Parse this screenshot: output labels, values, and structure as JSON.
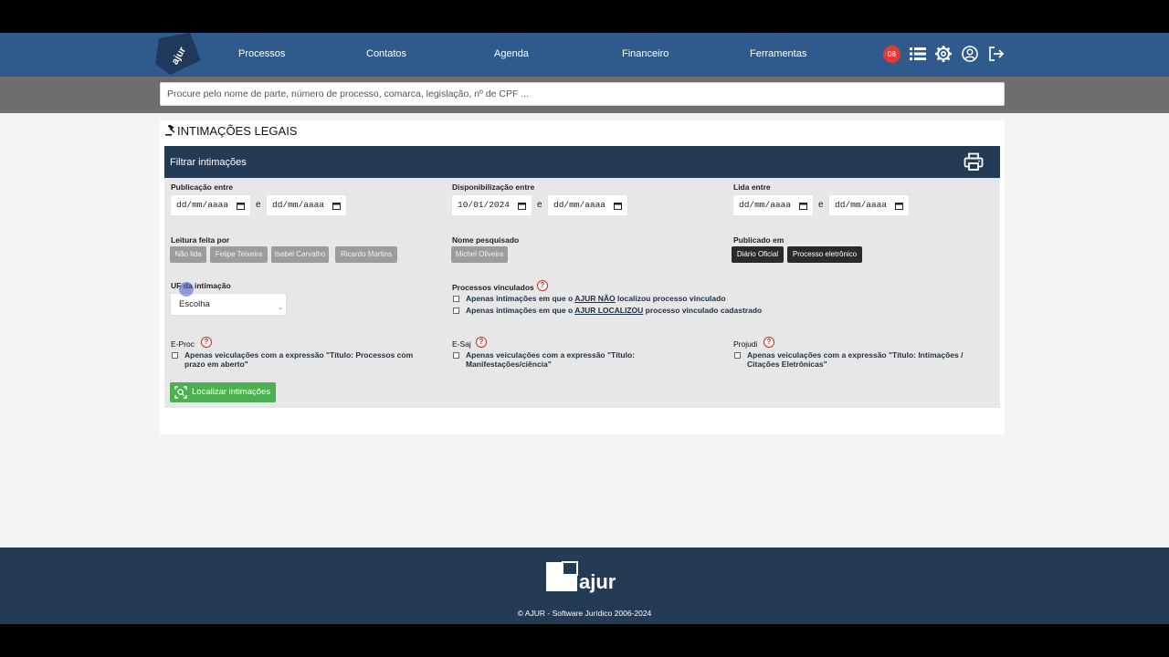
{
  "nav": {
    "links": [
      "Processos",
      "Contatos",
      "Agenda",
      "Financeiro",
      "Ferramentas"
    ],
    "notification_count": "08",
    "icons": [
      "list-icon",
      "gear-icon",
      "user-circle-icon",
      "logout-icon"
    ]
  },
  "search": {
    "placeholder": "Procure pelo nome de parte, número de processo, comarca, legislação, nº de CPF ..."
  },
  "page": {
    "title": "INTIMAÇÕES LEGAIS"
  },
  "filter": {
    "header": "Filtrar intimações",
    "publicacao": {
      "label": "Publicação entre",
      "from": "dd/mm/aaaa",
      "to": "dd/mm/aaaa",
      "sep": "e"
    },
    "disponibilizacao": {
      "label": "Disponibilização entre",
      "from": "10/01/2024",
      "to": "dd/mm/aaaa",
      "sep": "e"
    },
    "lida": {
      "label": "Lida entre",
      "from": "dd/mm/aaaa",
      "to": "dd/mm/aaaa",
      "sep": "e"
    },
    "leitura": {
      "label": "Leitura feita por",
      "chips": [
        "Não lida",
        "Felipe Teixeira",
        "Isabel Carvalho",
        "Ricardo Martins"
      ]
    },
    "nome": {
      "label": "Nome pesquisado",
      "chips": [
        "Michel Oliveira"
      ]
    },
    "publicado": {
      "label": "Publicado em",
      "chips": [
        "Diário Oficial",
        "Processo eletrônico"
      ]
    },
    "uf": {
      "label": "UF da intimação",
      "selected": "Escolha"
    },
    "vinculados": {
      "label": "Processos vinculados",
      "opt1_pre": "Apenas intimações em que o ",
      "opt1_em": "AJUR NÃO",
      "opt1_post": " localizou processo vinculado",
      "opt2_pre": "Apenas intimações em que o ",
      "opt2_em": "AJUR LOCALIZOU",
      "opt2_post": " processo vinculado cadastrado"
    },
    "eproc": {
      "label": "E-Proc",
      "line1": "Apenas veiculações com a expressão \"Título: Processos com",
      "line2": "prazo em aberto\""
    },
    "esaj": {
      "label": "E-Saj",
      "line1": "Apenas veiculações com a expressão \"Título:",
      "line2": "Manifestações/ciência\""
    },
    "projudi": {
      "label": "Projudi",
      "line1": "Apenas veiculações com a expressão \"Título: Intimações /",
      "line2": "Citações Eletrônicas\""
    },
    "submit": "Localizar intimações"
  },
  "footer": {
    "copyright": "© AJUR - Software Jurídico 2006-2024"
  },
  "colors": {
    "nav": "#2e5b8c",
    "header": "#243b55",
    "green": "#4caf50",
    "badge": "#e53935"
  }
}
